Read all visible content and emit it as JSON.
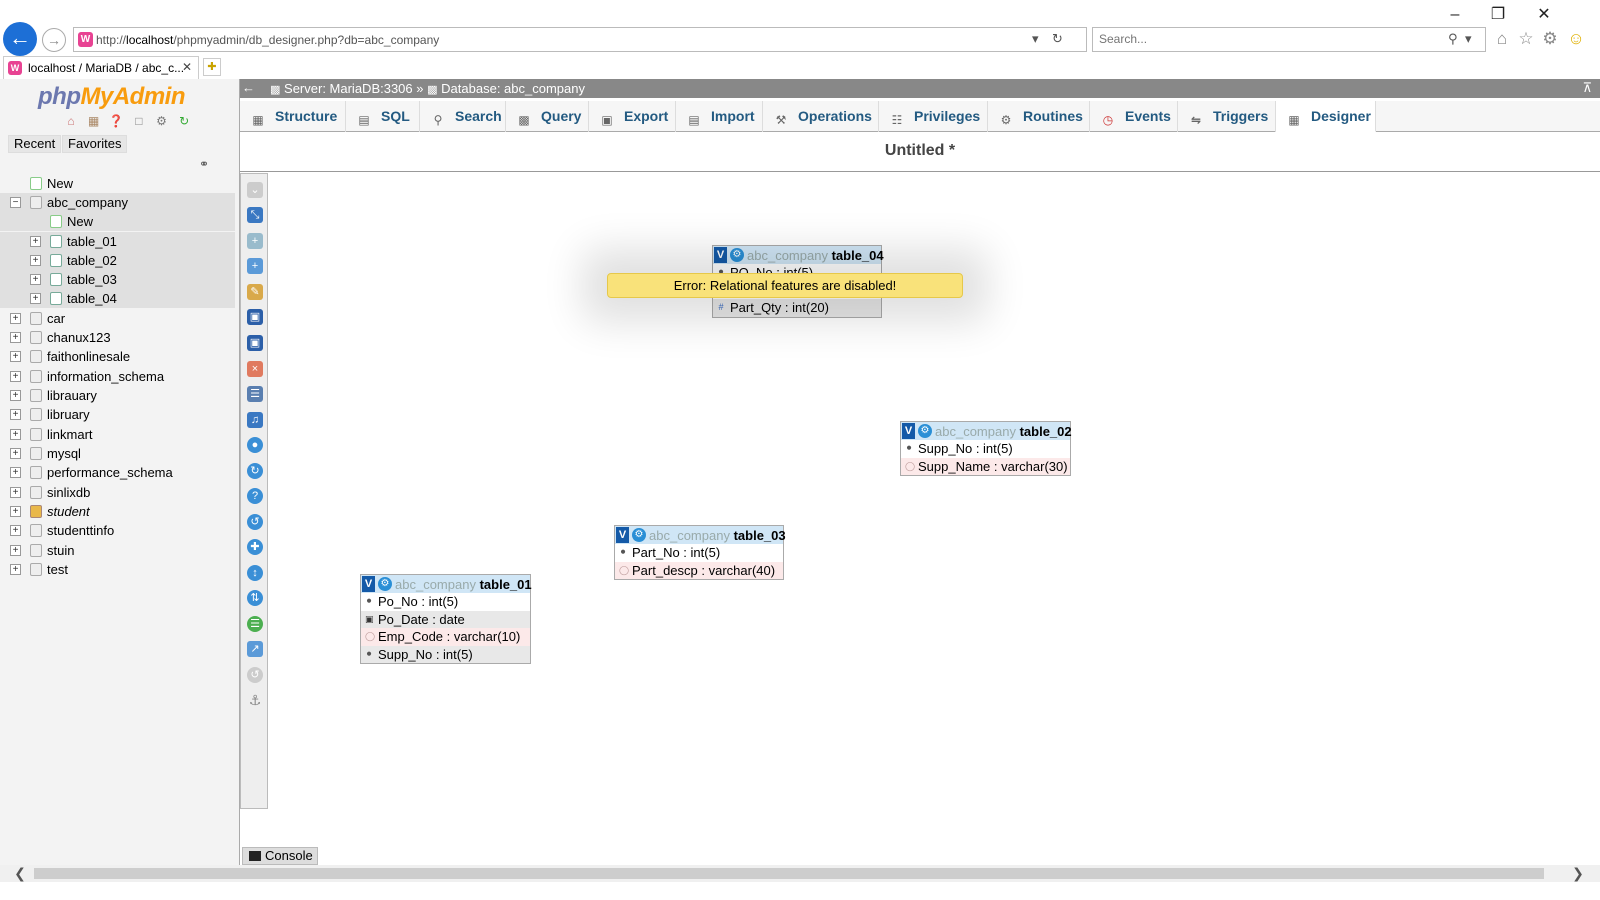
{
  "browser": {
    "url_prefix": "http://",
    "url_host": "localhost",
    "url_path": "/phpmyadmin/db_designer.php?db=abc_company",
    "search_placeholder": "Search...",
    "tab_label": "localhost / MariaDB / abc_c...",
    "favicon_letter": "W",
    "window_buttons": [
      "minimize-icon",
      "restore-icon",
      "close-icon"
    ],
    "toolbar_icons": [
      "home-icon",
      "star-icon",
      "gear-icon",
      "smiley-icon"
    ]
  },
  "nav": {
    "logo_php": "php",
    "logo_myadmin": "MyAdmin",
    "tabs": {
      "recent": "Recent",
      "favorites": "Favorites"
    },
    "tree": {
      "new_root": "New",
      "current_db": "abc_company",
      "new_table": "New",
      "tables": [
        "table_01",
        "table_02",
        "table_03",
        "table_04"
      ],
      "databases": [
        "car",
        "chanux123",
        "faithonlinesale",
        "information_schema",
        "librauary",
        "libruary",
        "linkmart",
        "mysql",
        "performance_schema",
        "sinlixdb",
        "student",
        "studenttinfo",
        "stuin",
        "test"
      ]
    }
  },
  "main": {
    "breadcrumb": {
      "server": "Server: MariaDB:3306",
      "sep": "»",
      "database": "Database: abc_company"
    },
    "menu": [
      "Structure",
      "SQL",
      "Search",
      "Query",
      "Export",
      "Import",
      "Operations",
      "Privileges",
      "Routines",
      "Events",
      "Triggers",
      "Designer"
    ],
    "page_title": "Untitled *",
    "error": "Error: Relational features are disabled!",
    "console": "Console"
  },
  "designer": {
    "tables": [
      {
        "db": "abc_company",
        "name": "table_04",
        "columns": [
          {
            "label": "PO_No : int(5)",
            "key": "primary",
            "shade": "white"
          },
          {
            "label": "",
            "key": "",
            "shade": "white"
          },
          {
            "label": "Part_Qty : int(20)",
            "key": "numeric",
            "shade": "grey"
          }
        ]
      },
      {
        "db": "abc_company",
        "name": "table_02",
        "columns": [
          {
            "label": "Supp_No : int(5)",
            "key": "primary",
            "shade": "white"
          },
          {
            "label": "Supp_Name : varchar(30)",
            "key": "text",
            "shade": "pink"
          }
        ]
      },
      {
        "db": "abc_company",
        "name": "table_03",
        "columns": [
          {
            "label": "Part_No : int(5)",
            "key": "primary",
            "shade": "white"
          },
          {
            "label": "Part_descp : varchar(40)",
            "key": "text",
            "shade": "pink"
          }
        ]
      },
      {
        "db": "abc_company",
        "name": "table_01",
        "columns": [
          {
            "label": "Po_No : int(5)",
            "key": "primary",
            "shade": "white"
          },
          {
            "label": "Po_Date : date",
            "key": "date",
            "shade": "grey"
          },
          {
            "label": "Emp_Code : varchar(10)",
            "key": "text",
            "shade": "pink"
          },
          {
            "label": "Supp_No : int(5)",
            "key": "primary",
            "shade": "grey"
          }
        ]
      }
    ]
  },
  "colors": {
    "accent_link": "#235a81",
    "breadcrumb_bg": "#888888",
    "table_header": "#d0e6f6",
    "error_bg": "#f9e27a"
  }
}
